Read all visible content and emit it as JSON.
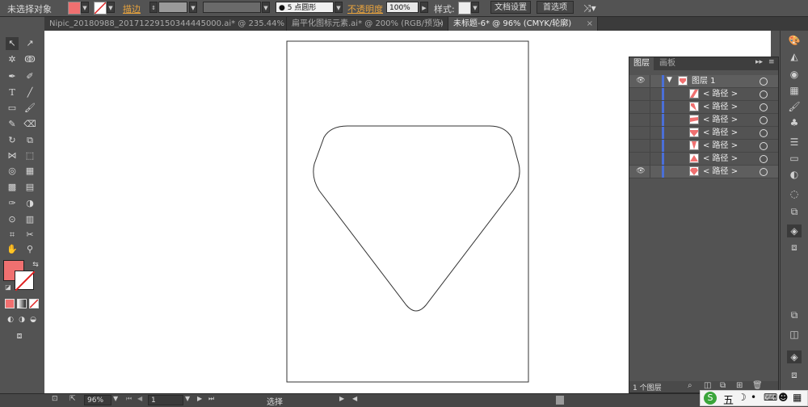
{
  "control_bar": {
    "selection_status": "未选择对象",
    "stroke_label": "描边",
    "brush_value": "5 点圆形",
    "opacity_label": "不透明度",
    "opacity_value": "100%",
    "style_label": "样式",
    "doc_setup_label": "文档设置",
    "prefs_label": "首选项"
  },
  "tabs": [
    {
      "label": "Nipic_20180988_20171229150344445000.ai* @ 235.44% (RGB/预览)",
      "active": false
    },
    {
      "label": "扁平化图标元素.ai* @ 200% (RGB/预览)",
      "active": false
    },
    {
      "label": "未标题-6* @ 96% (CMYK/轮廓)",
      "active": true
    }
  ],
  "layers_panel": {
    "tab_layers": "图层",
    "tab_artboards": "画板",
    "layer_name": "图层 1",
    "paths": [
      {
        "label": "< 路径 >",
        "thumb": "diagonal"
      },
      {
        "label": "< 路径 >",
        "thumb": "left-wedge"
      },
      {
        "label": "< 路径 >",
        "thumb": "band"
      },
      {
        "label": "< 路径 >",
        "thumb": "heart"
      },
      {
        "label": "< 路径 >",
        "thumb": "v-shape"
      },
      {
        "label": "< 路径 >",
        "thumb": "triangle"
      },
      {
        "label": "< 路径 >",
        "thumb": "gem"
      }
    ],
    "footer_count": "1 个图层"
  },
  "status_bar": {
    "zoom": "96%",
    "artboard_number": "1",
    "tool_name": "选择"
  },
  "ime": {
    "char": "五"
  },
  "colors": {
    "fill": "#f07070",
    "accent_blue": "#4a6fd8",
    "stroke_label": "#e8a33d"
  }
}
